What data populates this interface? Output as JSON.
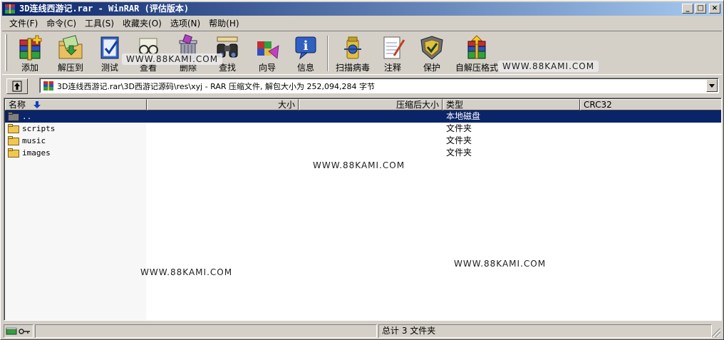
{
  "window": {
    "title": "3D连线西游记.rar - WinRAR (评估版本)",
    "minimize": "_",
    "maximize": "□",
    "close": "×"
  },
  "menu": [
    "文件(F)",
    "命令(C)",
    "工具(S)",
    "收藏夹(O)",
    "选项(N)",
    "帮助(H)"
  ],
  "toolbar": {
    "add": "添加",
    "extract": "解压到",
    "test": "测试",
    "view": "查看",
    "delete": "删除",
    "find": "查找",
    "wizard": "向导",
    "info": "信息",
    "virus_scan": "扫描病毒",
    "comment": "注释",
    "protect": "保护",
    "sfx": "自解压格式"
  },
  "watermark": "WWW.88KAMI.COM",
  "path": {
    "text": "3D连线西游记.rar\\3D西游记源码\\res\\xyj - RAR 压缩文件, 解包大小为 252,094,284 字节"
  },
  "columns": {
    "name": "名称",
    "size": "大小",
    "packed": "压缩后大小",
    "type": "类型",
    "crc": "CRC32"
  },
  "files": [
    {
      "name": "..",
      "type": "本地磁盘"
    },
    {
      "name": "scripts",
      "type": "文件夹"
    },
    {
      "name": "music",
      "type": "文件夹"
    },
    {
      "name": "images",
      "type": "文件夹"
    }
  ],
  "status": {
    "summary": "总计 3 文件夹"
  },
  "colors": {
    "selection": "#0a246a",
    "titlebar_start": "#0a246a",
    "titlebar_end": "#a6caf0",
    "folder": "#f0c850"
  }
}
